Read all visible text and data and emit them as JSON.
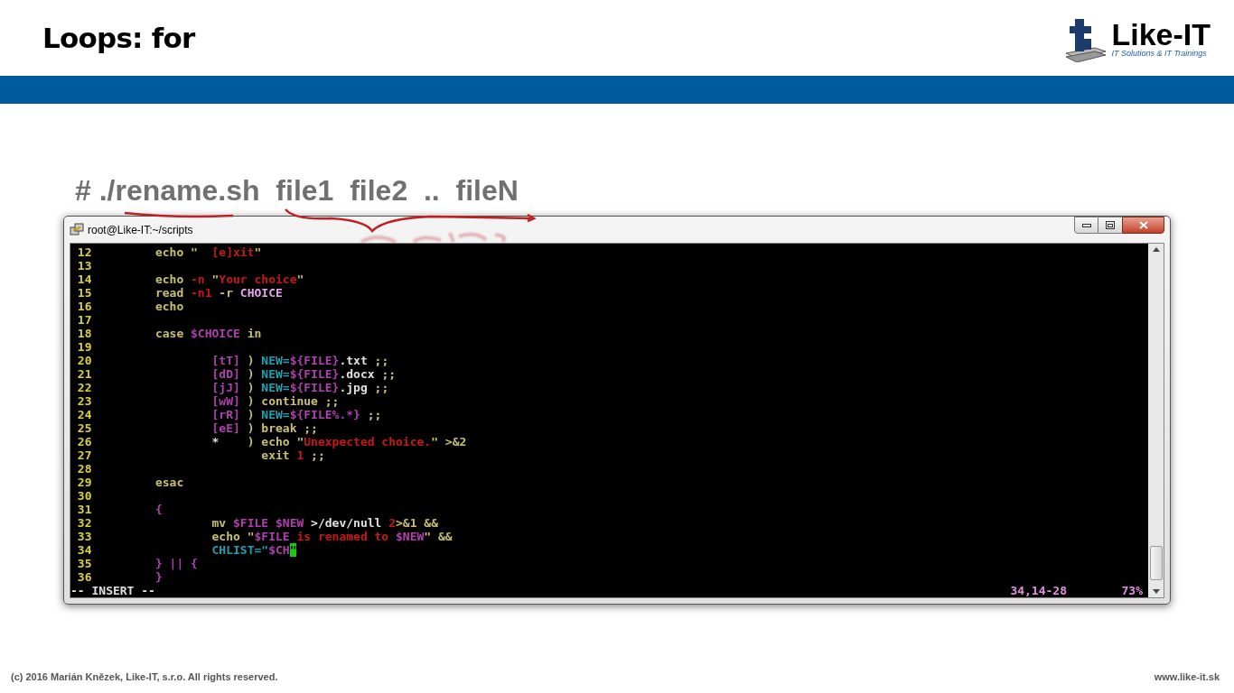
{
  "slide": {
    "title": "Loops: for",
    "logo": {
      "name": "Like-IT",
      "tagline": "IT Solutions & IT Trainings"
    },
    "command": "# ./rename.sh  file1  file2  ..  fileN",
    "footer_left": "(c) 2016 Marián Knězek, Like-IT, s.r.o. All rights reserved.",
    "footer_right": "www.like-it.sk"
  },
  "terminal": {
    "title": "root@Like-IT:~/scripts",
    "lines": [
      {
        "number": "12",
        "segments": [
          {
            "text": "        echo \"  ",
            "color": "#c8c070"
          },
          {
            "text": "[e]xit",
            "color": "#c81818"
          },
          {
            "text": "\"",
            "color": "#c8c070"
          }
        ]
      },
      {
        "number": "13"
      },
      {
        "number": "14",
        "segments": [
          {
            "text": "        echo ",
            "color": "#c8c070"
          },
          {
            "text": "-n ",
            "color": "#c81818"
          },
          {
            "text": "\"",
            "color": "#c8c070"
          },
          {
            "text": "Your choice",
            "color": "#c81818"
          },
          {
            "text": "\"",
            "color": "#c8c070"
          }
        ]
      },
      {
        "number": "15",
        "segments": [
          {
            "text": "        read ",
            "color": "#c8c070"
          },
          {
            "text": "-n1",
            "color": "#c81818"
          },
          {
            "text": " -r ",
            "color": "#c8c070"
          },
          {
            "text": "CHOICE",
            "color": "#e8a8f0"
          }
        ]
      },
      {
        "number": "16",
        "segments": [
          {
            "text": "        echo",
            "color": "#c8c070"
          }
        ]
      },
      {
        "number": "17"
      },
      {
        "number": "18",
        "segments": [
          {
            "text": "        case ",
            "color": "#c8c070"
          },
          {
            "text": "$CHOICE",
            "color": "#b040b0"
          },
          {
            "text": " in",
            "color": "#c8c070"
          }
        ]
      },
      {
        "number": "19"
      },
      {
        "number": "20",
        "segments": [
          {
            "text": "                [tT]",
            "color": "#b040b0"
          },
          {
            "text": " ) ",
            "color": "#c8c070"
          },
          {
            "text": "NEW=",
            "color": "#20a0b0"
          },
          {
            "text": "${FILE}",
            "color": "#b040b0"
          },
          {
            "text": ".txt",
            "color": "#e0e0e0"
          },
          {
            "text": " ;;",
            "color": "#c8c070"
          }
        ]
      },
      {
        "number": "21",
        "segments": [
          {
            "text": "                [dD]",
            "color": "#b040b0"
          },
          {
            "text": " ) ",
            "color": "#c8c070"
          },
          {
            "text": "NEW=",
            "color": "#20a0b0"
          },
          {
            "text": "${FILE}",
            "color": "#b040b0"
          },
          {
            "text": ".docx",
            "color": "#e0e0e0"
          },
          {
            "text": " ;;",
            "color": "#c8c070"
          }
        ]
      },
      {
        "number": "22",
        "segments": [
          {
            "text": "                [jJ]",
            "color": "#b040b0"
          },
          {
            "text": " ) ",
            "color": "#c8c070"
          },
          {
            "text": "NEW=",
            "color": "#20a0b0"
          },
          {
            "text": "${FILE}",
            "color": "#b040b0"
          },
          {
            "text": ".jpg",
            "color": "#e0e0e0"
          },
          {
            "text": " ;;",
            "color": "#c8c070"
          }
        ]
      },
      {
        "number": "23",
        "segments": [
          {
            "text": "                [wW]",
            "color": "#b040b0"
          },
          {
            "text": " ) continue ;;",
            "color": "#c8c070"
          }
        ]
      },
      {
        "number": "24",
        "segments": [
          {
            "text": "                [rR]",
            "color": "#b040b0"
          },
          {
            "text": " ) ",
            "color": "#c8c070"
          },
          {
            "text": "NEW=",
            "color": "#20a0b0"
          },
          {
            "text": "${FILE%.*}",
            "color": "#b040b0"
          },
          {
            "text": " ;;",
            "color": "#c8c070"
          }
        ]
      },
      {
        "number": "25",
        "segments": [
          {
            "text": "                [eE]",
            "color": "#b040b0"
          },
          {
            "text": " ) break ;;",
            "color": "#c8c070"
          }
        ]
      },
      {
        "number": "26",
        "segments": [
          {
            "text": "                *",
            "color": "#e0e0e0"
          },
          {
            "text": "    ) echo \"",
            "color": "#c8c070"
          },
          {
            "text": "Unexpected choice.",
            "color": "#c81818"
          },
          {
            "text": "\" >&2",
            "color": "#c8c070"
          }
        ]
      },
      {
        "number": "27",
        "segments": [
          {
            "text": "                       exit ",
            "color": "#c8c070"
          },
          {
            "text": "1",
            "color": "#c81818"
          },
          {
            "text": " ;;",
            "color": "#c8c070"
          }
        ]
      },
      {
        "number": "28"
      },
      {
        "number": "29",
        "segments": [
          {
            "text": "        esac",
            "color": "#c8c070"
          }
        ]
      },
      {
        "number": "30"
      },
      {
        "number": "31",
        "segments": [
          {
            "text": "        {",
            "color": "#b040b0"
          }
        ]
      },
      {
        "number": "32",
        "segments": [
          {
            "text": "                mv ",
            "color": "#c8c070"
          },
          {
            "text": "$FILE $NEW",
            "color": "#b040b0"
          },
          {
            "text": " >/dev/null ",
            "color": "#e0e0e0"
          },
          {
            "text": "2",
            "color": "#c81818"
          },
          {
            "text": ">&1 &&",
            "color": "#c8c070"
          }
        ]
      },
      {
        "number": "33",
        "segments": [
          {
            "text": "                echo \"",
            "color": "#c8c070"
          },
          {
            "text": "$FILE",
            "color": "#b040b0"
          },
          {
            "text": " is renamed to ",
            "color": "#c81818"
          },
          {
            "text": "$NEW",
            "color": "#b040b0"
          },
          {
            "text": "\" &&",
            "color": "#c8c070"
          }
        ]
      },
      {
        "number": "34",
        "segments": [
          {
            "text": "                CHLIST=\"",
            "color": "#20a0b0"
          },
          {
            "text": "$CH",
            "color": "#b040b0"
          },
          {
            "text": "\"",
            "color": "#10d010",
            "cursor": true
          }
        ]
      },
      {
        "number": "35",
        "segments": [
          {
            "text": "        } || {",
            "color": "#b040b0"
          }
        ]
      },
      {
        "number": "36",
        "segments": [
          {
            "text": "        }",
            "color": "#b040b0"
          }
        ]
      }
    ],
    "mode": "-- INSERT --",
    "position": "34,14-28",
    "percent": "73%"
  }
}
